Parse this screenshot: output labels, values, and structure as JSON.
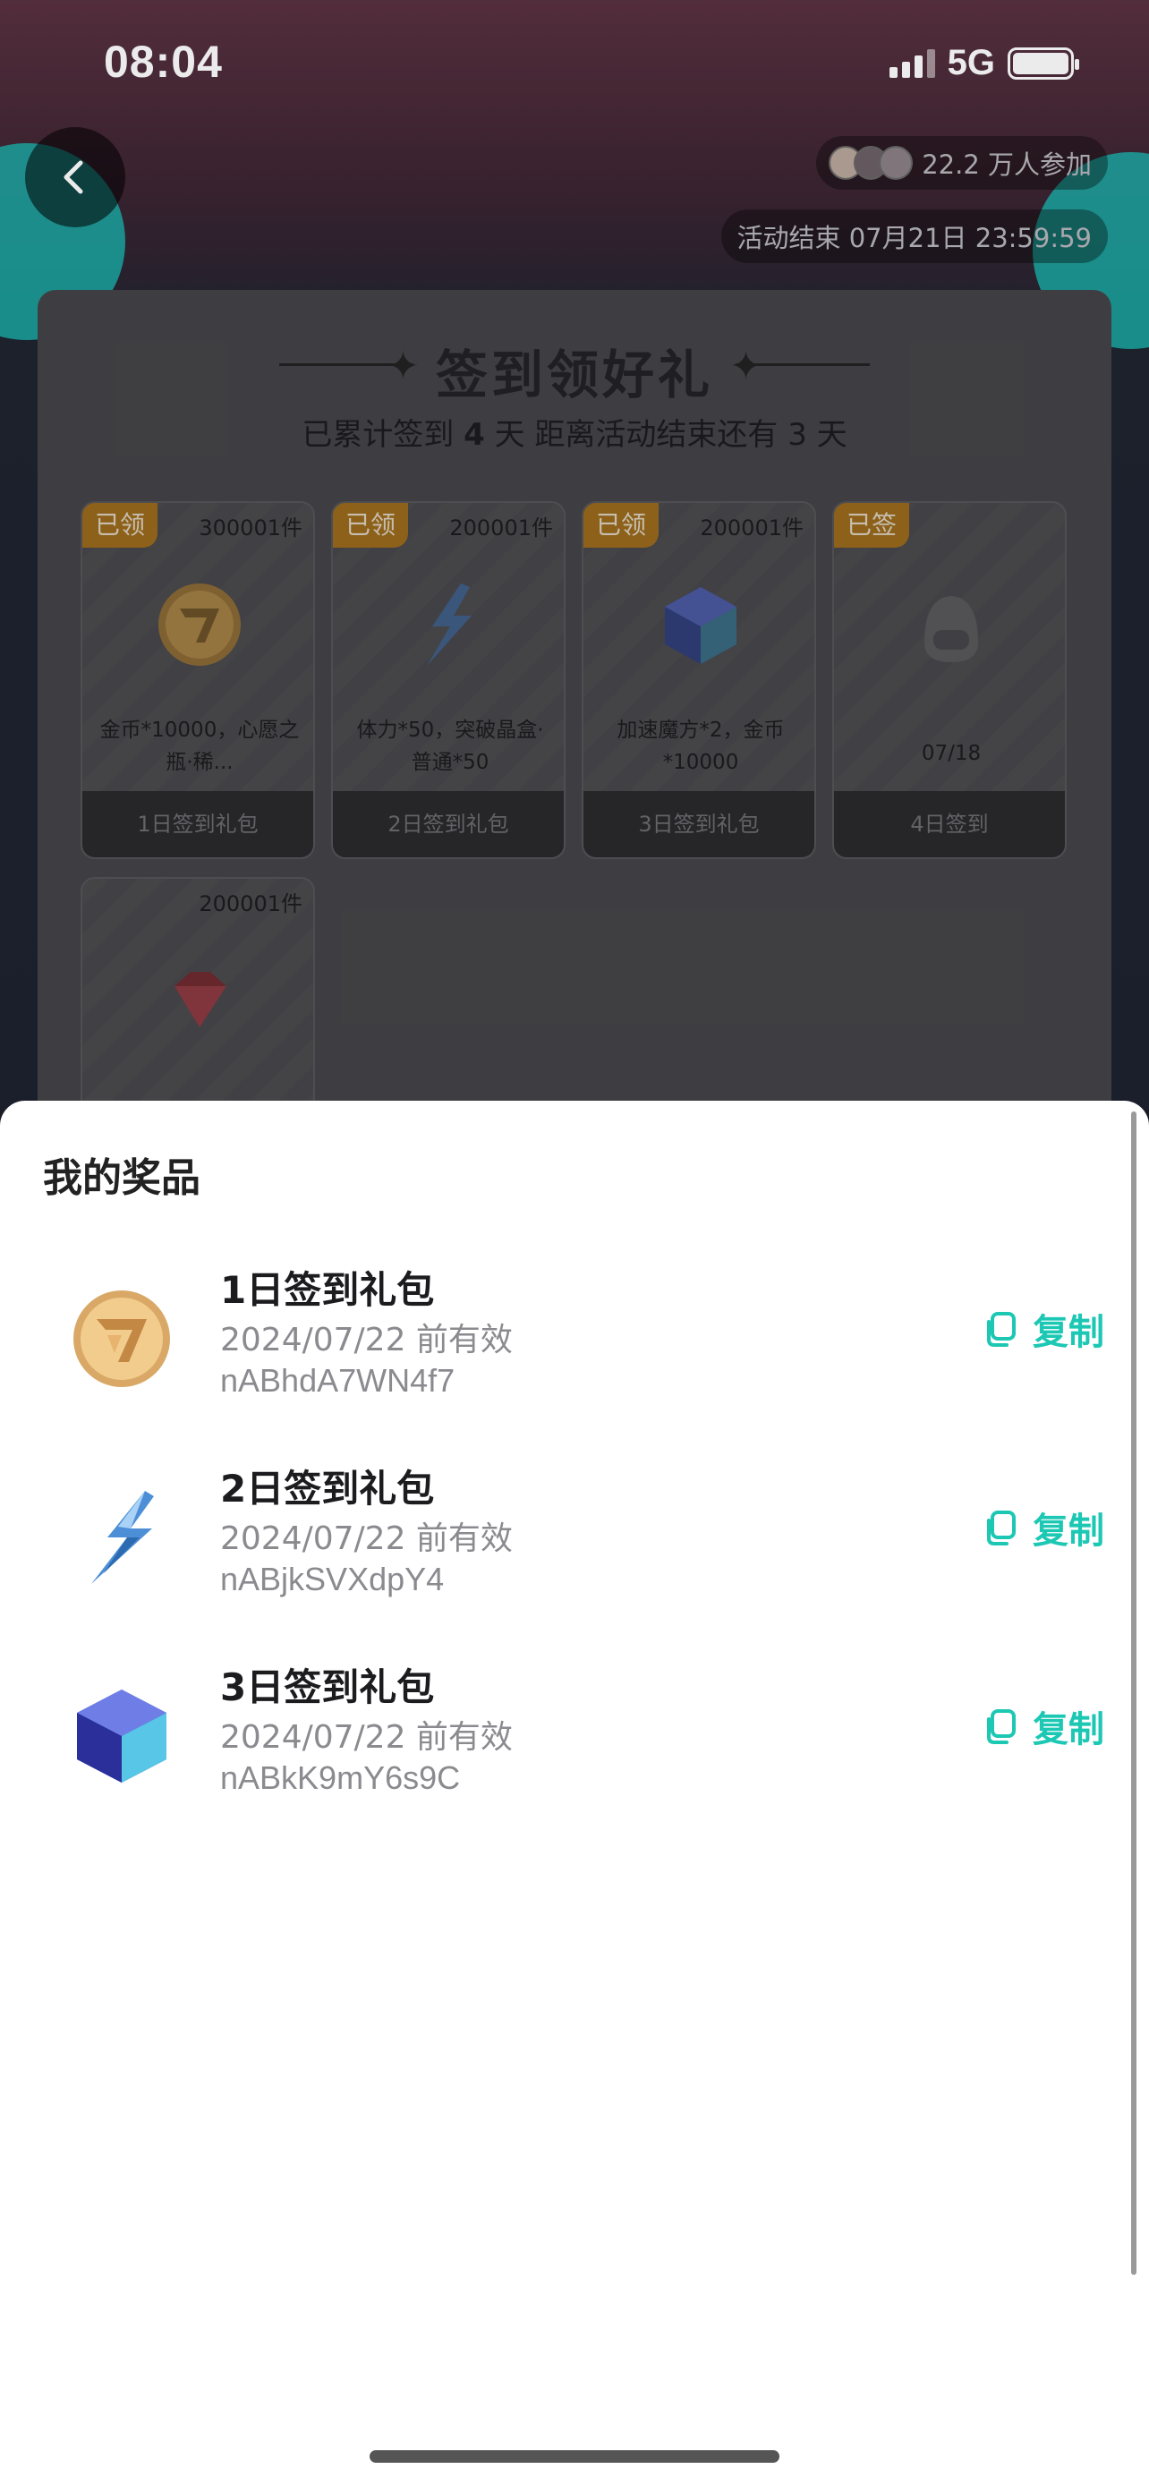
{
  "status_bar": {
    "time": "08:04",
    "network": "5G"
  },
  "header": {
    "participants": "22.2 万人参加",
    "end_time": "活动结束 07月21日 23:59:59"
  },
  "signin": {
    "title": "签到领好礼",
    "subtitle_prefix": "已累计签到",
    "days_signed": "4",
    "subtitle_mid": "天  距离活动结束还有",
    "days_left": "3",
    "subtitle_suffix": "天",
    "days": [
      {
        "badge": "已领",
        "stock": "300001件",
        "desc": "金币*10000，心愿之瓶·稀...",
        "foot": "1日签到礼包",
        "icon": "gold-coin-icon"
      },
      {
        "badge": "已领",
        "stock": "200001件",
        "desc": "体力*50，突破晶盒·普通*50",
        "foot": "2日签到礼包",
        "icon": "lightning-icon"
      },
      {
        "badge": "已领",
        "stock": "200001件",
        "desc": "加速魔方*2，金币*10000",
        "foot": "3日签到礼包",
        "icon": "cube-icon"
      },
      {
        "badge": "已签",
        "stock": "",
        "desc": "07/18",
        "foot": "4日签到",
        "icon": "mascot-icon"
      },
      {
        "badge": "",
        "stock": "200001件",
        "desc": "",
        "foot": "",
        "icon": "diamond-icon"
      }
    ]
  },
  "prizes": {
    "title": "我的奖品",
    "copy_label": "复制",
    "items": [
      {
        "name": "1日签到礼包",
        "valid": "2024/07/22 前有效",
        "code": "nABhdA7WN4f7",
        "icon": "gold-coin-icon"
      },
      {
        "name": "2日签到礼包",
        "valid": "2024/07/22 前有效",
        "code": "nABjkSVXdpY4",
        "icon": "lightning-icon"
      },
      {
        "name": "3日签到礼包",
        "valid": "2024/07/22 前有效",
        "code": "nABkK9mY6s9C",
        "icon": "cube-icon"
      }
    ]
  },
  "colors": {
    "accent": "#1cc8b4",
    "badge": "#9a6a1c"
  }
}
